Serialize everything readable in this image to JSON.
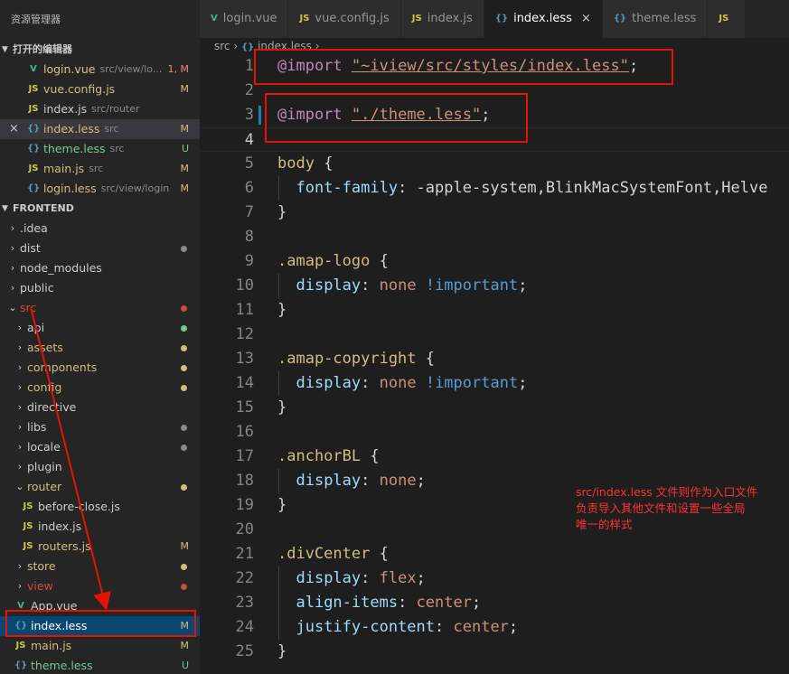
{
  "explorer": {
    "title": "资源管理器",
    "open_editors_label": "打开的编辑器",
    "open_editors": [
      {
        "name": "login.vue",
        "desc": "src/view/lo...",
        "status": "1, M",
        "type": "vue",
        "status_kind": "err"
      },
      {
        "name": "vue.config.js",
        "desc": "",
        "status": "M",
        "type": "js",
        "status_kind": "mod"
      },
      {
        "name": "index.js",
        "desc": "src/router",
        "status": "",
        "type": "js",
        "status_kind": ""
      },
      {
        "name": "index.less",
        "desc": "src",
        "status": "M",
        "type": "less",
        "status_kind": "mod"
      },
      {
        "name": "theme.less",
        "desc": "src",
        "status": "U",
        "type": "less",
        "status_kind": "untr"
      },
      {
        "name": "main.js",
        "desc": "src",
        "status": "M",
        "type": "js",
        "status_kind": "mod"
      },
      {
        "name": "login.less",
        "desc": "src/view/login",
        "status": "M",
        "type": "less",
        "status_kind": "mod"
      }
    ],
    "project_label": "FRONTEND",
    "tree": [
      {
        "name": ".idea",
        "kind": "folder",
        "depth": 0,
        "open": false,
        "dot": ""
      },
      {
        "name": "dist",
        "kind": "folder",
        "depth": 0,
        "open": false,
        "dot": "#8a8a8a"
      },
      {
        "name": "node_modules",
        "kind": "folder",
        "depth": 0,
        "open": false,
        "dot": ""
      },
      {
        "name": "public",
        "kind": "folder",
        "depth": 0,
        "open": false,
        "dot": ""
      },
      {
        "name": "src",
        "kind": "folder",
        "depth": 0,
        "open": true,
        "dot": "#c74e39",
        "color": "err"
      },
      {
        "name": "api",
        "kind": "folder",
        "depth": 1,
        "open": false,
        "dot": "#73c991"
      },
      {
        "name": "assets",
        "kind": "folder",
        "depth": 1,
        "open": false,
        "dot": "#d7ba7d",
        "color": "mod"
      },
      {
        "name": "components",
        "kind": "folder",
        "depth": 1,
        "open": false,
        "dot": "#d7ba7d",
        "color": "mod"
      },
      {
        "name": "config",
        "kind": "folder",
        "depth": 1,
        "open": false,
        "dot": "#d7ba7d",
        "color": "mod"
      },
      {
        "name": "directive",
        "kind": "folder",
        "depth": 1,
        "open": false,
        "dot": ""
      },
      {
        "name": "libs",
        "kind": "folder",
        "depth": 1,
        "open": false,
        "dot": "#8a8a8a"
      },
      {
        "name": "locale",
        "kind": "folder",
        "depth": 1,
        "open": false,
        "dot": "#8a8a8a"
      },
      {
        "name": "plugin",
        "kind": "folder",
        "depth": 1,
        "open": false,
        "dot": ""
      },
      {
        "name": "router",
        "kind": "folder",
        "depth": 1,
        "open": true,
        "dot": "#d7ba7d",
        "color": "mod"
      },
      {
        "name": "before-close.js",
        "kind": "js",
        "depth": 2,
        "badge": ""
      },
      {
        "name": "index.js",
        "kind": "js",
        "depth": 2,
        "badge": ""
      },
      {
        "name": "routers.js",
        "kind": "js",
        "depth": 2,
        "badge": "M",
        "color": "mod"
      },
      {
        "name": "store",
        "kind": "folder",
        "depth": 1,
        "open": false,
        "dot": "#d7ba7d",
        "color": "mod"
      },
      {
        "name": "view",
        "kind": "folder",
        "depth": 1,
        "open": false,
        "dot": "#c74e39",
        "color": "err"
      },
      {
        "name": "App.vue",
        "kind": "vue",
        "depth": 1,
        "badge": ""
      },
      {
        "name": "index.less",
        "kind": "less",
        "depth": 1,
        "badge": "M",
        "selected": true
      },
      {
        "name": "main.js",
        "kind": "js",
        "depth": 1,
        "badge": "M",
        "color": "mod"
      },
      {
        "name": "theme.less",
        "kind": "less",
        "depth": 1,
        "badge": "U",
        "color": "untr"
      }
    ]
  },
  "tabs": [
    {
      "name": "login.vue",
      "type": "vue",
      "active": false
    },
    {
      "name": "vue.config.js",
      "type": "js",
      "active": false
    },
    {
      "name": "index.js",
      "type": "js",
      "active": false
    },
    {
      "name": "index.less",
      "type": "less",
      "active": true
    },
    {
      "name": "theme.less",
      "type": "less",
      "active": false
    },
    {
      "name": "",
      "type": "js",
      "active": false
    }
  ],
  "breadcrumb": {
    "folder": "src",
    "file": "index.less"
  },
  "code_lines": [
    [
      [
        "kw",
        "@import"
      ],
      [
        "",
        ""
      ],
      [
        "str",
        "\"~iview/src/styles/index.less\""
      ],
      [
        "",
        ";"
      ]
    ],
    [],
    [
      [
        "kw",
        "@import"
      ],
      [
        "",
        ""
      ],
      [
        "str",
        "\"./theme.less\""
      ],
      [
        "",
        ";"
      ]
    ],
    [],
    [
      [
        "sel",
        "body"
      ],
      [
        "",
        " {"
      ]
    ],
    [
      [
        "",
        ""
      ],
      [
        "prop",
        "font-family"
      ],
      [
        "",
        ": -apple-system,BlinkMacSystemFont,Helve"
      ]
    ],
    [
      [
        "",
        "}"
      ]
    ],
    [],
    [
      [
        "sel",
        ".amap-logo"
      ],
      [
        "",
        " {"
      ]
    ],
    [
      [
        "",
        ""
      ],
      [
        "prop",
        "display"
      ],
      [
        "",
        ": "
      ],
      [
        "val",
        "none"
      ],
      [
        "",
        " "
      ],
      [
        "imp",
        "!important"
      ],
      [
        "",
        ";"
      ]
    ],
    [
      [
        "",
        "}"
      ]
    ],
    [],
    [
      [
        "sel",
        ".amap-copyright"
      ],
      [
        "",
        " {"
      ]
    ],
    [
      [
        "",
        ""
      ],
      [
        "prop",
        "display"
      ],
      [
        "",
        ": "
      ],
      [
        "val",
        "none"
      ],
      [
        "",
        " "
      ],
      [
        "imp",
        "!important"
      ],
      [
        "",
        ";"
      ]
    ],
    [
      [
        "",
        "}"
      ]
    ],
    [],
    [
      [
        "sel",
        ".anchorBL"
      ],
      [
        "",
        " {"
      ]
    ],
    [
      [
        "",
        ""
      ],
      [
        "prop",
        "display"
      ],
      [
        "",
        ": "
      ],
      [
        "val",
        "none"
      ],
      [
        "",
        ";"
      ]
    ],
    [
      [
        "",
        "}"
      ]
    ],
    [],
    [
      [
        "sel",
        ".divCenter"
      ],
      [
        "",
        " {"
      ]
    ],
    [
      [
        "",
        ""
      ],
      [
        "prop",
        "display"
      ],
      [
        "",
        ": "
      ],
      [
        "val",
        "flex"
      ],
      [
        "",
        ";"
      ]
    ],
    [
      [
        "",
        ""
      ],
      [
        "prop",
        "align-items"
      ],
      [
        "",
        ": "
      ],
      [
        "val",
        "center"
      ],
      [
        "",
        ";"
      ]
    ],
    [
      [
        "",
        ""
      ],
      [
        "prop",
        "justify-content"
      ],
      [
        "",
        ": "
      ],
      [
        "val",
        "center"
      ],
      [
        "",
        ";"
      ]
    ],
    [
      [
        "",
        "}"
      ]
    ]
  ],
  "annotation": {
    "line1": "src/index.less 文件则作为入口文件",
    "line2": "负责导入其他文件和设置一些全局",
    "line3": "唯一的样式"
  },
  "colors": {
    "highlight_box": "#e51400",
    "arrow": "#e51400",
    "selection": "#094771"
  }
}
